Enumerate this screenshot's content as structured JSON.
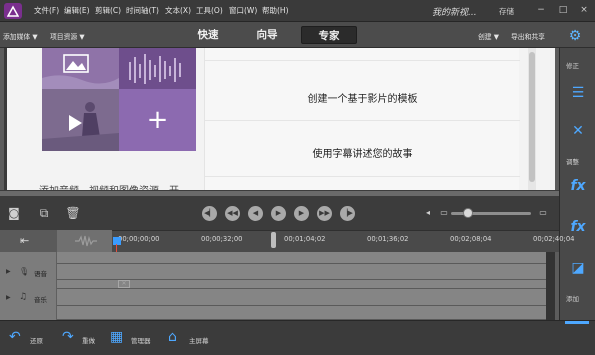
{
  "menubar": {
    "items": [
      "文件(F)",
      "编辑(E)",
      "剪辑(C)",
      "时间轴(T)",
      "文本(X)",
      "工具(O)",
      "窗口(W)",
      "帮助(H)"
    ],
    "project_title": "我的新视...",
    "save_label": "存储",
    "window_controls": [
      "−",
      "□",
      "×"
    ]
  },
  "modebar": {
    "add_media": "添加媒体 ▼",
    "project_assets": "项目资源 ▼",
    "tabs": [
      "快速",
      "向导",
      "专家"
    ],
    "active_tab": "专家",
    "create": "创建 ▼",
    "export_share": "导出和共享",
    "settings_icon": "gear-icon"
  },
  "monitor": {
    "caption": "添加音频、视频和图像资源，开",
    "lines": [
      "创建一个基于影片的模板",
      "使用字幕讲述您的故事"
    ]
  },
  "actionbar": {
    "sections": [
      "修正",
      "调整",
      "添加"
    ],
    "accent": "#4ea8ff"
  },
  "timeline": {
    "timecodes": [
      "00;00;00;00",
      "00;00;32;00",
      "00;01;04;02",
      "00;01;36;02",
      "00;02;08;04",
      "00;02;40;04"
    ],
    "tracks": [
      "语音",
      "音乐"
    ]
  },
  "bottombar": {
    "undo": "还原",
    "redo": "重做",
    "organizer": "管理器",
    "home": "主屏幕"
  }
}
